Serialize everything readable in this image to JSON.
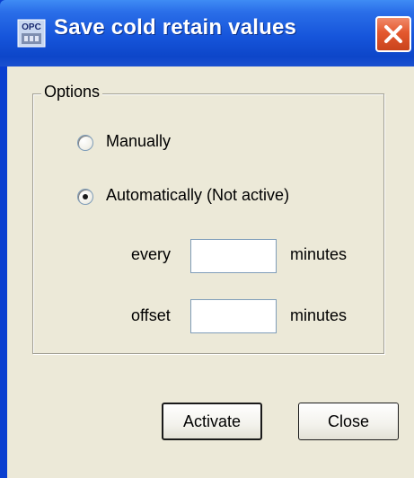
{
  "window": {
    "title": "Save cold retain values",
    "icon": "opc-icon",
    "close_icon": "close-icon"
  },
  "options": {
    "group_label": "Options",
    "manual_label": "Manually",
    "automatic_label": "Automatically (Not active)",
    "selected": "automatic",
    "every_label": "every",
    "every_value": "",
    "every_unit": "minutes",
    "offset_label": "offset",
    "offset_value": "",
    "offset_unit": "minutes"
  },
  "buttons": {
    "activate": "Activate",
    "close": "Close"
  },
  "colors": {
    "titlebar": "#1655db",
    "close_button": "#e4582e",
    "dialog_bg": "#ece9d8"
  }
}
